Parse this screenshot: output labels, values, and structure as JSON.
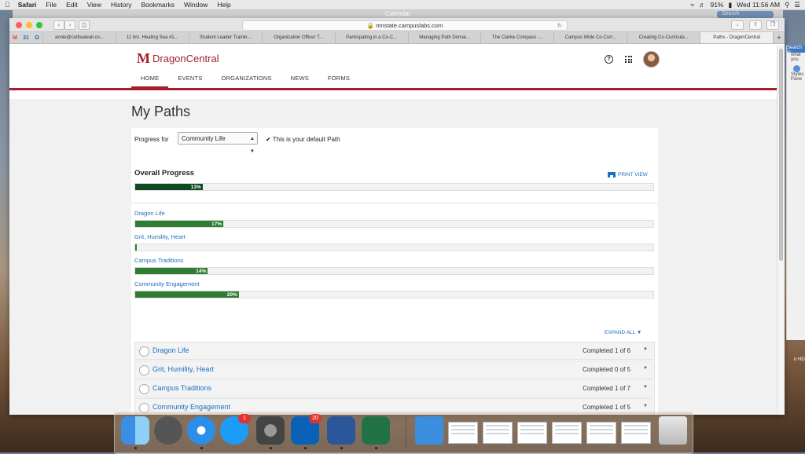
{
  "menubar": {
    "app": "Safari",
    "items": [
      "File",
      "Edit",
      "View",
      "History",
      "Bookmarks",
      "Window",
      "Help"
    ],
    "battery": "91%",
    "clock": "Wed 11:56 AM"
  },
  "background_window": {
    "title": "Calendar",
    "search_placeholder": "Search"
  },
  "browser": {
    "url": "mnstate.campuslabs.com",
    "tabs": [
      "annie@cultivateall.co...",
      "11 hrs. Healing Sea #1...",
      "Student Leader Trainin...",
      "Organization Officer T...",
      "Participating in a Co-C...",
      "Managing Path Domai...",
      "The Clarke Compass -...",
      "Campus Wide Co-Curr...",
      "Creating Co-Curricula...",
      "Paths - DragonCentral"
    ],
    "active_tab_index": 9
  },
  "site": {
    "logo_mark": "M",
    "logo_text": "DragonCentral",
    "nav": [
      "HOME",
      "EVENTS",
      "ORGANIZATIONS",
      "NEWS",
      "FORMS"
    ],
    "nav_active": "HOME",
    "help_icon": "?"
  },
  "page": {
    "title": "My Paths",
    "progress_for_label": "Progress for",
    "selected_path": "Community Life",
    "default_note": "This is your default Path",
    "overall_title": "Overall Progress",
    "print_view": "PRINT VIEW",
    "overall_progress": {
      "percent": 13,
      "label": "13%"
    },
    "categories": [
      {
        "name": "Dragon Life",
        "percent": 17,
        "label": "17%"
      },
      {
        "name": "Grit, Humility, Heart",
        "percent": 0,
        "label": ""
      },
      {
        "name": "Campus Traditions",
        "percent": 14,
        "label": "14%"
      },
      {
        "name": "Community Engagement",
        "percent": 20,
        "label": "20%"
      }
    ],
    "expand_all": "EXPAND ALL",
    "accordion": [
      {
        "title": "Dragon Life",
        "status": "Completed 1 of 6"
      },
      {
        "title": "Grit, Humility, Heart",
        "status": "Completed 0 of 5"
      },
      {
        "title": "Campus Traditions",
        "status": "Completed 1 of 7"
      },
      {
        "title": "Community Engagement",
        "status": "Completed 1 of 5"
      }
    ]
  },
  "side_panel": {
    "search_text": "Search in",
    "what_text": "what you",
    "styles_label": "Styles Pane",
    "hd_label": "n HD"
  },
  "dock": {
    "apps": [
      "finder-icon",
      "launchpad-icon",
      "safari-icon",
      "app-store-icon",
      "system-preferences-icon",
      "outlook-icon",
      "word-icon",
      "excel-icon"
    ],
    "app_store_badge": "1",
    "outlook_badge": "20",
    "colors": {
      "brand": "#a51d2d",
      "link": "#1a6fc0",
      "progress_dark": "#0f4a23",
      "progress": "#2e7d32"
    }
  }
}
